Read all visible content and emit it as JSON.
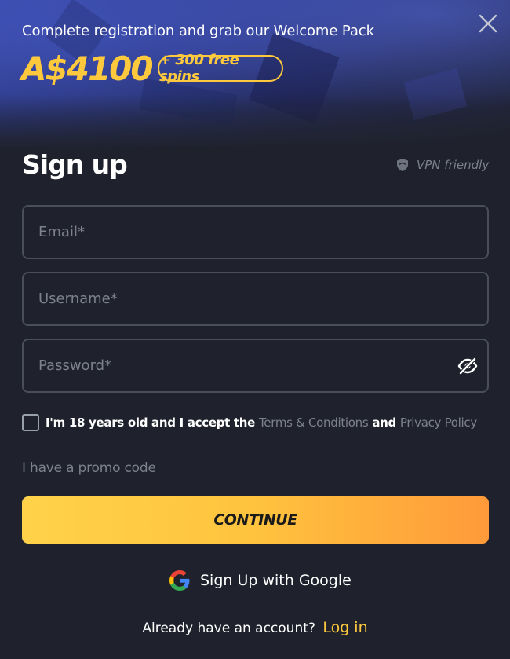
{
  "header": {
    "promo_text": "Complete registration and grab our Welcome Pack",
    "bonus_amount": "A$4100",
    "free_spins": "+ 300 free spins"
  },
  "form": {
    "title": "Sign up",
    "vpn_label": "VPN friendly",
    "email": {
      "placeholder": "Email*",
      "value": ""
    },
    "username": {
      "placeholder": "Username*",
      "value": ""
    },
    "password": {
      "placeholder": "Password*",
      "value": ""
    },
    "consent": {
      "checked": false,
      "text_before": "I'm 18 years old and I accept the",
      "terms_link": "Terms & Conditions",
      "text_and": "and",
      "privacy_link": "Privacy Policy"
    },
    "promo_code_link": "I have a promo code",
    "continue_label": "CONTINUE",
    "google_label": "Sign Up with Google",
    "login_prompt": "Already have an account?",
    "login_link": "Log in"
  },
  "icons": {
    "close": "close-icon",
    "shield": "shield-icon",
    "eye": "eye-slash-icon",
    "google": "google-icon"
  },
  "colors": {
    "background": "#1f222c",
    "accent": "#ffc93d",
    "button_gradient_start": "#ffd24a",
    "button_gradient_end": "#ff9a3a",
    "muted_text": "#7d818c",
    "field_border": "#4a4e59"
  }
}
